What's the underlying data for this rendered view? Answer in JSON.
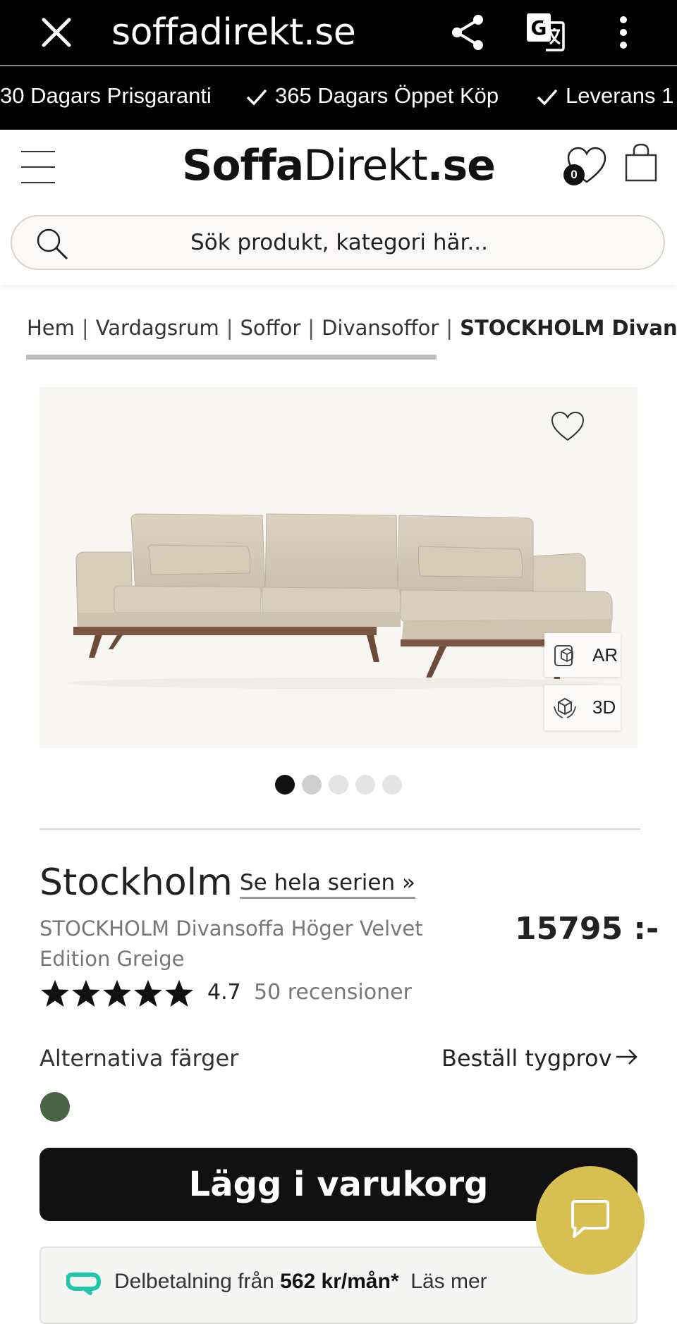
{
  "browser": {
    "url": "soffadirekt.se",
    "icons": [
      "close-icon",
      "share-icon",
      "translate-icon",
      "more-vert-icon"
    ]
  },
  "usp": {
    "items": [
      "30 Dagars Prisgaranti",
      "365 Dagars Öppet Köp",
      "Leverans 1"
    ]
  },
  "header": {
    "logo_bold": "Soffa",
    "logo_regular": "Direkt",
    "logo_tld": ".se",
    "wishlist_count": "0",
    "search_placeholder": "Sök produkt, kategori här..."
  },
  "breadcrumb": {
    "items": [
      "Hem",
      "Vardagsrum",
      "Soffor",
      "Divansoffor"
    ],
    "separator": "|",
    "current": "STOCKHOLM Divansoffa Höger Velvet Edition Greige"
  },
  "gallery": {
    "ar_label": "AR",
    "3d_label": "3D",
    "active_slide": 1,
    "total_slides": 5
  },
  "product": {
    "series": "Stockholm",
    "series_link": "Se hela serien »",
    "name": "STOCKHOLM Divansoffa Höger Velvet Edition Greige",
    "price": "15795 :-",
    "rating": "4.7",
    "stars": 5,
    "reviews": "50 recensioner",
    "alt_colors_label": "Alternativa färger",
    "fabric_sample": "Beställ tygprov",
    "swatch_color": "#4a6346",
    "add_to_cart": "Lägg i varukorg"
  },
  "finance": {
    "prefix": "Delbetalning från",
    "amount": "562 kr/mån*",
    "link": "Läs mer"
  },
  "colors": {
    "chat": "#d8bf52",
    "cart": "#111111",
    "finance_logo": "#1cc8a8"
  }
}
